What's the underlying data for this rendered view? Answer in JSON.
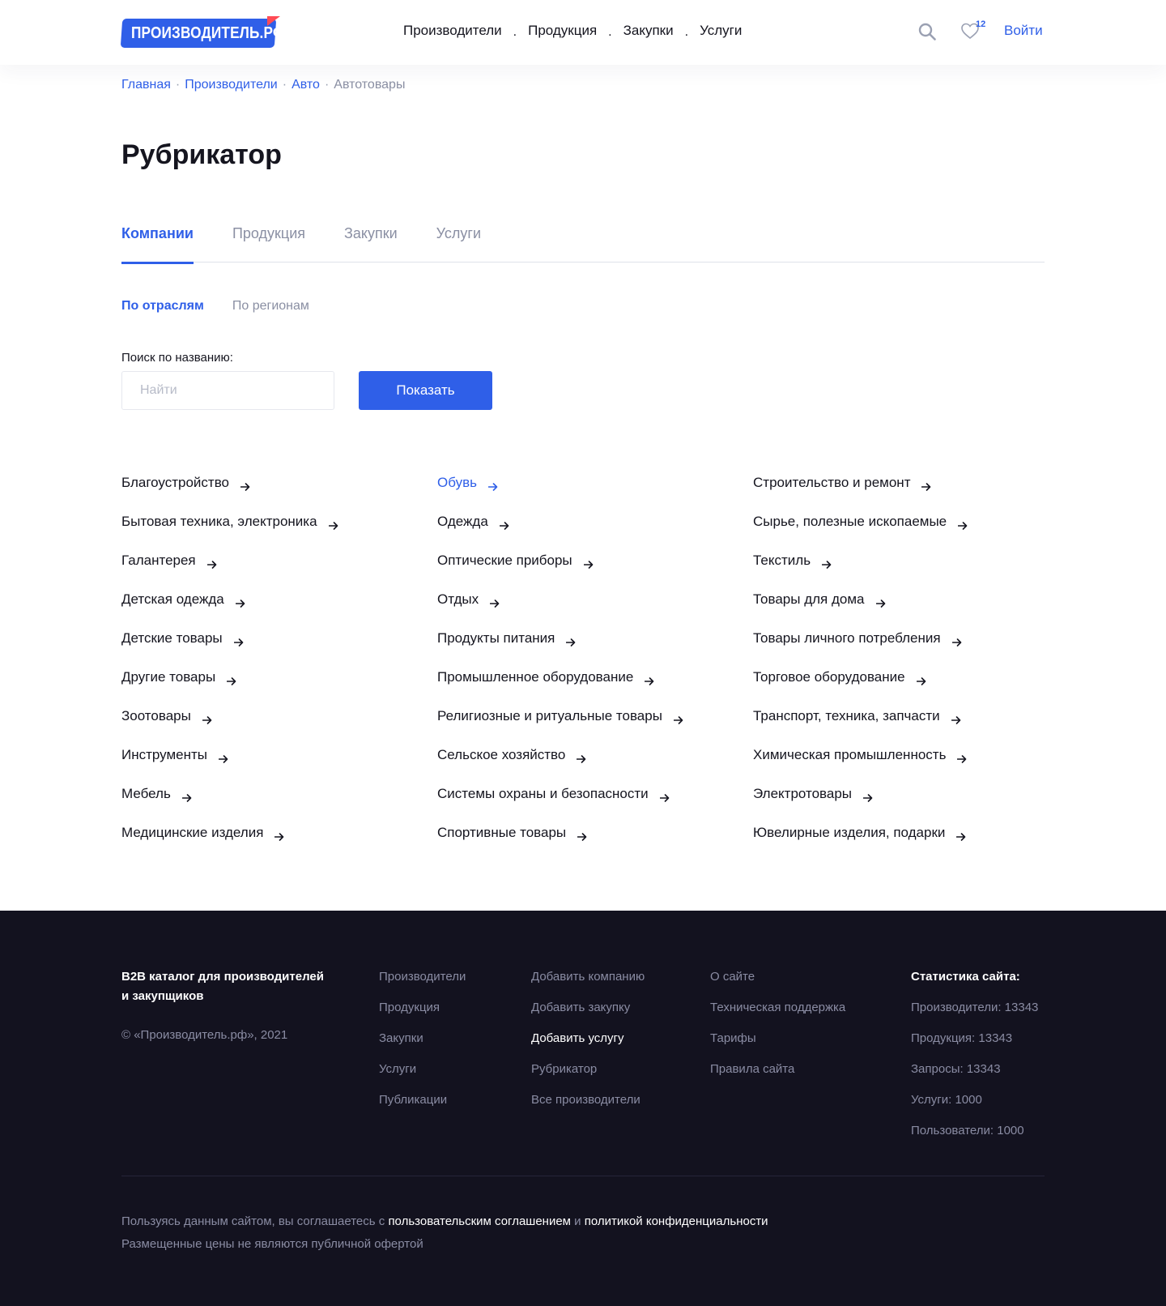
{
  "header": {
    "logo_text": "ПРОИЗВОДИТЕЛЬ.РФ",
    "nav": [
      "Производители",
      "Продукция",
      "Закупки",
      "Услуги"
    ],
    "nav_separator": ".",
    "favorites_count": "12",
    "login_label": "Войти"
  },
  "breadcrumb": {
    "links": [
      "Главная",
      "Производители",
      "Авто"
    ],
    "current": "Автотовары",
    "separator": "·"
  },
  "page_title": "Рубрикатор",
  "tabs": [
    "Компании",
    "Продукция",
    "Закупки",
    "Услуги"
  ],
  "subtabs": [
    "По отраслям",
    "По регионам"
  ],
  "search": {
    "label": "Поиск по названию:",
    "placeholder": "Найти",
    "value": "",
    "button": "Показать"
  },
  "categories": {
    "col1": [
      "Благоустройство",
      "Бытовая техника, электроника",
      "Галантерея",
      "Детская одежда",
      "Детские товары",
      "Другие товары",
      "Зоотовары",
      "Инструменты",
      "Мебель",
      "Медицинские изделия"
    ],
    "col2": [
      "Обувь",
      "Одежда",
      "Оптические приборы",
      "Отдых",
      "Продукты питания",
      "Промышленное оборудование",
      "Религиозные и ритуальные товары",
      "Сельское хозяйство",
      "Системы охраны и безопасности",
      "Спортивные товары"
    ],
    "col3": [
      "Строительство и ремонт",
      "Сырье, полезные ископаемые",
      "Текстиль",
      "Товары для дома",
      "Товары личного потребления",
      "Торговое оборудование",
      "Транспорт, техника, запчасти",
      "Химическая промышленность",
      "Электротовары",
      "Ювелирные изделия, подарки"
    ]
  },
  "footer": {
    "about_title_line1": "B2B каталог для производителей",
    "about_title_line2": "и закупщиков",
    "copyright": "© «Производитель.рф», 2021",
    "col1": [
      "Производители",
      "Продукция",
      "Закупки",
      "Услуги",
      "Публикации"
    ],
    "col2": [
      "Добавить компанию",
      "Добавить закупку",
      "Добавить услугу",
      "Рубрикатор",
      "Все производители"
    ],
    "col3": [
      "О сайте",
      "Техническая поддержка",
      "Тарифы",
      "Правила сайта"
    ],
    "stats_title": "Статистика сайта:",
    "stats": [
      "Производители: 13343",
      "Продукция: 13343",
      "Запросы: 13343",
      "Услуги: 1000",
      "Пользователи: 1000"
    ],
    "legal_prefix": "Пользуясь данным сайтом, вы соглашаетесь с",
    "legal_link1": "пользовательским соглашением",
    "legal_and": "и",
    "legal_link2": "политикой конфиденциальности",
    "legal_line2": "Размещенные цены не являются публичной офертой"
  },
  "colors": {
    "accent": "#2f5fe8",
    "text": "#15151f",
    "muted": "#8a8fa3",
    "footer_bg": "#13121f",
    "logo_flag": "#ff4b55"
  },
  "icons": [
    "search-icon",
    "heart-icon",
    "arrow-right-icon"
  ]
}
